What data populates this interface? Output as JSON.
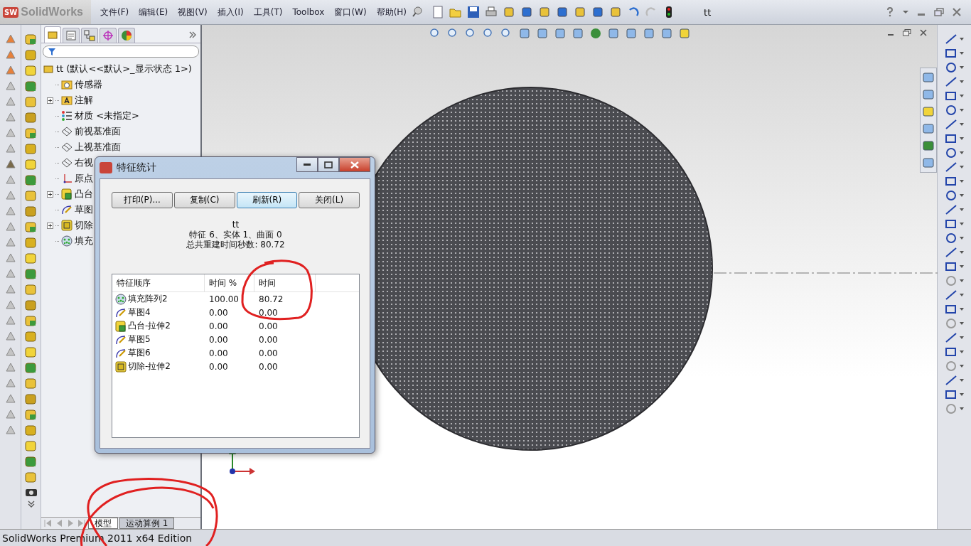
{
  "app": {
    "logo_mark": "SW",
    "name": "SolidWorks"
  },
  "menu": [
    "文件(F)",
    "编辑(E)",
    "视图(V)",
    "插入(I)",
    "工具(T)",
    "Toolbox",
    "窗口(W)",
    "帮助(H)"
  ],
  "document_title": "tt",
  "feature_tabs": [
    {
      "kind": "features",
      "selected": true
    },
    {
      "kind": "properties",
      "selected": false
    },
    {
      "kind": "configurations",
      "selected": false
    },
    {
      "kind": "dimxpert",
      "selected": false
    },
    {
      "kind": "display",
      "selected": false
    }
  ],
  "tree": {
    "root": "tt  (默认<<默认>_显示状态 1>)",
    "items": [
      {
        "kind": "sensor",
        "label": "传感器",
        "collapsed": false
      },
      {
        "kind": "annotation",
        "label": "注解",
        "collapsed": true
      },
      {
        "kind": "material",
        "label": "材质 <未指定>",
        "collapsed": false
      },
      {
        "kind": "plane",
        "label": "前视基准面",
        "collapsed": false
      },
      {
        "kind": "plane",
        "label": "上视基准面",
        "collapsed": false
      },
      {
        "kind": "plane",
        "label": "右视",
        "collapsed": false
      },
      {
        "kind": "origin",
        "label": "原点",
        "collapsed": false
      },
      {
        "kind": "boss",
        "label": "凸台",
        "collapsed": true
      },
      {
        "kind": "sketch",
        "label": "草图",
        "collapsed": false
      },
      {
        "kind": "cut",
        "label": "切除",
        "collapsed": true
      },
      {
        "kind": "pattern",
        "label": "填充",
        "collapsed": false
      }
    ]
  },
  "dialog": {
    "title": "特征统计",
    "buttons": [
      {
        "label": "打印(P)...",
        "focused": false
      },
      {
        "label": "复制(C)",
        "focused": false
      },
      {
        "label": "刷新(R)",
        "focused": true
      },
      {
        "label": "关闭(L)",
        "focused": false
      }
    ],
    "part_name": "tt",
    "summary": "特征 6、实体 1、曲面 0",
    "total_time": "总共重建时间秒数: 80.72",
    "columns": [
      "特征顺序",
      "时间 %",
      "时间"
    ],
    "rows": [
      {
        "kind": "pattern",
        "name": "填充阵列2",
        "percent": "100.00",
        "time": "80.72"
      },
      {
        "kind": "sketch",
        "name": "草图4",
        "percent": "0.00",
        "time": "0.00"
      },
      {
        "kind": "boss",
        "name": "凸台-拉伸2",
        "percent": "0.00",
        "time": "0.00"
      },
      {
        "kind": "sketch",
        "name": "草图5",
        "percent": "0.00",
        "time": "0.00"
      },
      {
        "kind": "sketch",
        "name": "草图6",
        "percent": "0.00",
        "time": "0.00"
      },
      {
        "kind": "cut",
        "name": "切除-拉伸2",
        "percent": "0.00",
        "time": "0.00"
      }
    ]
  },
  "bottom_tabs": [
    {
      "label": "模型",
      "selected": true
    },
    {
      "label": "运动算例 1",
      "selected": false
    }
  ],
  "status_bar": "SolidWorks Premium 2011 x64 Edition"
}
